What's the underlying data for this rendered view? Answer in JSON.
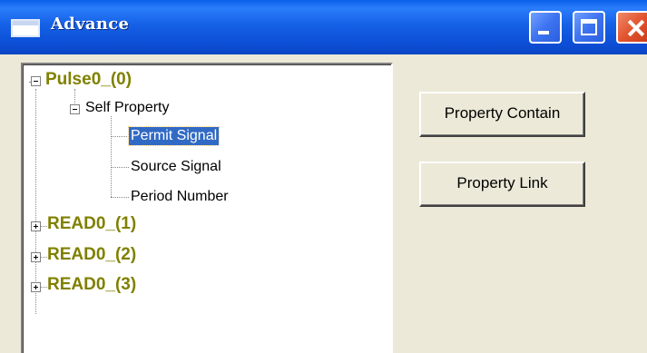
{
  "window": {
    "title": "Advance"
  },
  "tree": {
    "root": {
      "label": "Pulse0_(0)",
      "expanded": true
    },
    "self_property": {
      "label": "Self Property",
      "expanded": true
    },
    "children": [
      {
        "label": "Permit Signal",
        "selected": true
      },
      {
        "label": "Source Signal",
        "selected": false
      },
      {
        "label": "Period Number",
        "selected": false
      }
    ],
    "collapsed_roots": [
      {
        "label": "READ0_(1)"
      },
      {
        "label": "READ0_(2)"
      },
      {
        "label": "READ0_(3)"
      }
    ]
  },
  "buttons": {
    "property_contain": "Property Contain",
    "property_link": "Property Link"
  },
  "colors": {
    "root_text": "#808000",
    "selection": "#316ac5",
    "titlebar": "#0c4fd6"
  }
}
